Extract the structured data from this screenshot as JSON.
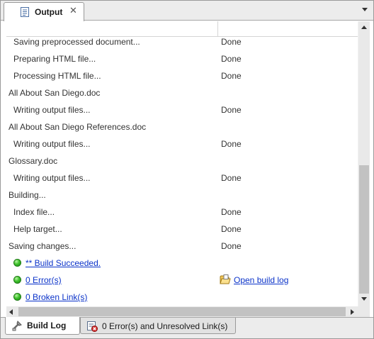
{
  "tab": {
    "title": "Output",
    "close_glyph": "✕",
    "icon": "document-icon"
  },
  "rows": [
    {
      "text": "Saving preprocessed document...",
      "status": "Done",
      "level": 1
    },
    {
      "text": "Preparing HTML file...",
      "status": "Done",
      "level": 1
    },
    {
      "text": "Processing HTML file...",
      "status": "Done",
      "level": 1
    },
    {
      "text": "All About San Diego.doc",
      "status": "",
      "level": 0
    },
    {
      "text": "Writing output files...",
      "status": "Done",
      "level": 1
    },
    {
      "text": "All About San Diego References.doc",
      "status": "",
      "level": 0
    },
    {
      "text": "Writing output files...",
      "status": "Done",
      "level": 1
    },
    {
      "text": "Glossary.doc",
      "status": "",
      "level": 0
    },
    {
      "text": "Writing output files...",
      "status": "Done",
      "level": 1
    },
    {
      "text": "Building...",
      "status": "",
      "level": 0
    },
    {
      "text": "Index file...",
      "status": "Done",
      "level": 1
    },
    {
      "text": "Help target...",
      "status": "Done",
      "level": 1
    },
    {
      "text": "Saving changes...",
      "status": "Done",
      "level": 0
    }
  ],
  "summary": {
    "build_succeeded": "** Build Succeeded.",
    "errors": "0 Error(s)",
    "broken_links": "0 Broken Link(s)",
    "open_build_log": "Open build log",
    "status_color": "#3fc22d"
  },
  "bottom_tabs": [
    {
      "label": "Build Log",
      "active": true,
      "icon": "build-log-icon"
    },
    {
      "label": "0 Error(s) and Unresolved Link(s)",
      "active": false,
      "icon": "error-list-icon"
    }
  ],
  "colors": {
    "link": "#0b33c9",
    "chrome": "#ececec",
    "scroll_thumb": "#c2c2c2"
  }
}
